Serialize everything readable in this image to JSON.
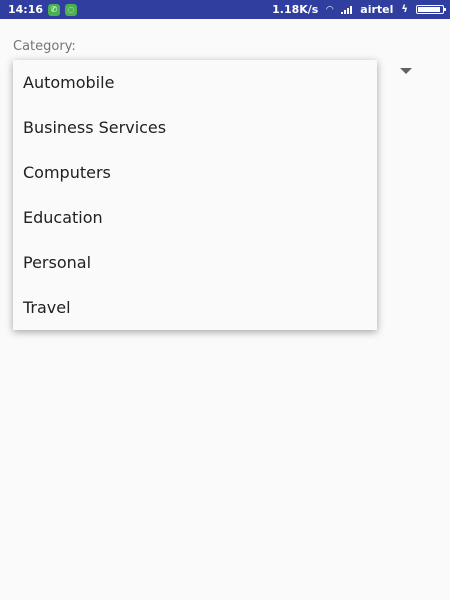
{
  "status_bar": {
    "time": "14:16",
    "network_speed": "1.18K/s",
    "carrier": "airtel",
    "battery_level": 0.9,
    "icons": [
      "phone-icon",
      "chat-icon",
      "wifi-icon",
      "signal-icon",
      "charging-icon",
      "battery-icon"
    ]
  },
  "form": {
    "category_label": "Category:"
  },
  "dropdown": {
    "options": [
      "Automobile",
      "Business Services",
      "Computers",
      "Education",
      "Personal",
      "Travel"
    ]
  },
  "colors": {
    "status_bar": "#303f9f",
    "background": "#fafafa",
    "text_primary": "#212121",
    "label": "#757575"
  }
}
